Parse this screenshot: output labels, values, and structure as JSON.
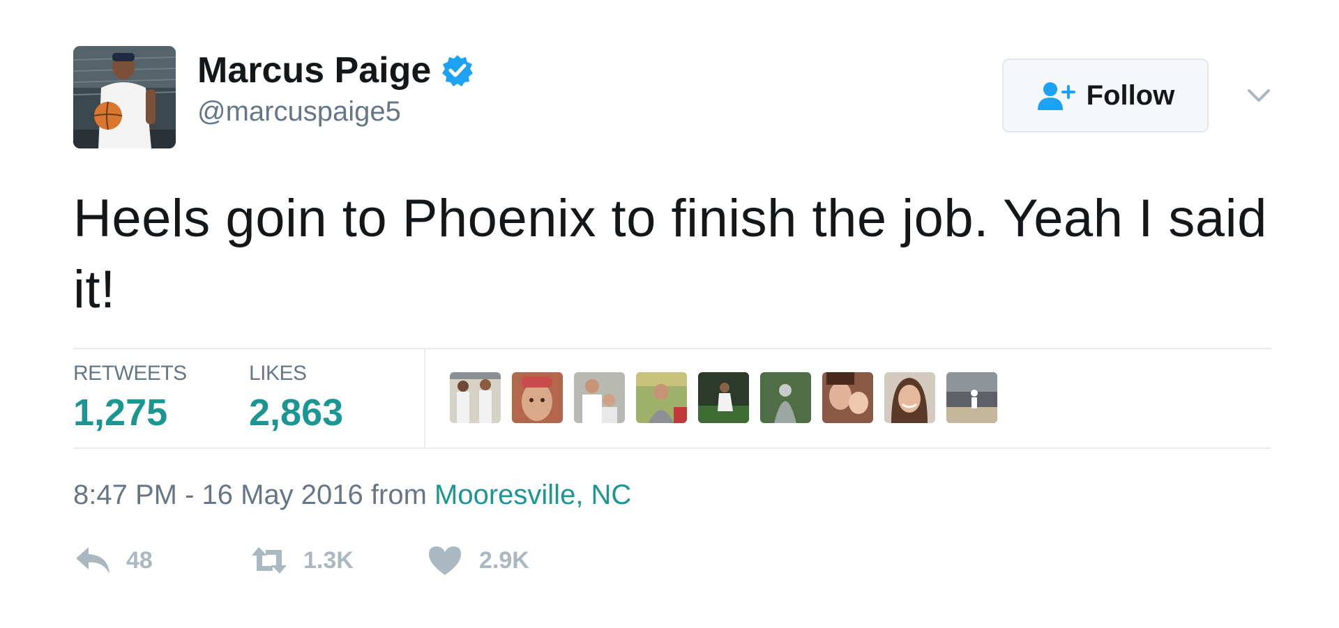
{
  "user": {
    "display_name": "Marcus Paige",
    "handle": "@marcuspaige5",
    "verified": true,
    "avatar_icon": "avatar-photo"
  },
  "follow_button": {
    "label": "Follow",
    "icon": "add-user-icon"
  },
  "menu": {
    "icon": "chevron-down-icon"
  },
  "tweet": {
    "text": "Heels goin to Phoenix to finish the job. Yeah I said it!"
  },
  "stats": {
    "retweets_label": "RETWEETS",
    "retweets_value": "1,275",
    "likes_label": "LIKES",
    "likes_value": "2,863",
    "liker_avatars": [
      "liker-avatar-1",
      "liker-avatar-2",
      "liker-avatar-3",
      "liker-avatar-4",
      "liker-avatar-5",
      "liker-avatar-6",
      "liker-avatar-7",
      "liker-avatar-8",
      "liker-avatar-9"
    ]
  },
  "meta": {
    "timestamp": "8:47 PM - 16 May 2016",
    "from_text": "from",
    "location": "Mooresville, NC"
  },
  "actions": {
    "reply_count": "48",
    "retweet_count": "1.3K",
    "like_count": "2.9K"
  },
  "colors": {
    "accent": "#1b9692",
    "verified": "#1da1f2",
    "muted": "#657786",
    "action_gray": "#aab8c2",
    "text": "#14171a"
  }
}
